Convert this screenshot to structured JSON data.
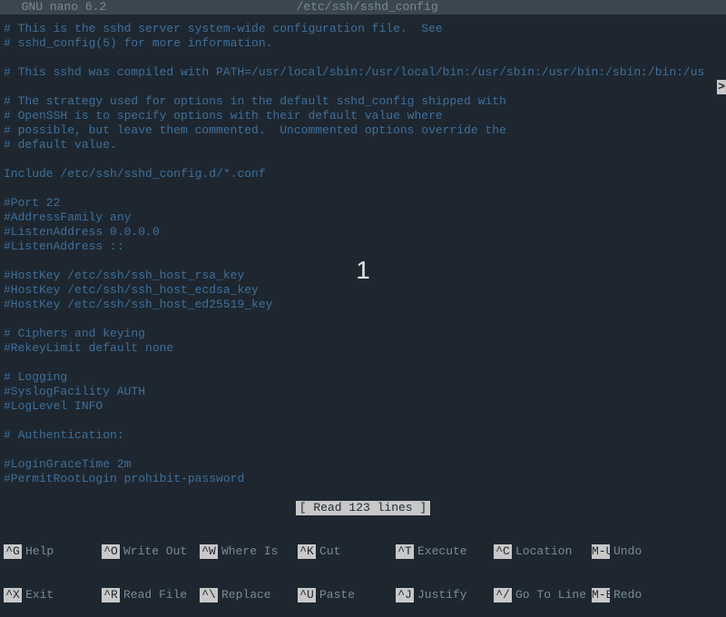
{
  "titlebar": {
    "app": "  GNU nano 6.2",
    "filename": "/etc/ssh/sshd_config"
  },
  "overlay": {
    "big_number": "1"
  },
  "status": {
    "message": "[ Read 123 lines ]"
  },
  "overflow_indicator": ">",
  "file_lines": [
    "# This is the sshd server system-wide configuration file.  See",
    "# sshd_config(5) for more information.",
    "",
    "# This sshd was compiled with PATH=/usr/local/sbin:/usr/local/bin:/usr/sbin:/usr/bin:/sbin:/bin:/us",
    "",
    "# The strategy used for options in the default sshd_config shipped with",
    "# OpenSSH is to specify options with their default value where",
    "# possible, but leave them commented.  Uncommented options override the",
    "# default value.",
    "",
    "Include /etc/ssh/sshd_config.d/*.conf",
    "",
    "#Port 22",
    "#AddressFamily any",
    "#ListenAddress 0.0.0.0",
    "#ListenAddress ::",
    "",
    "#HostKey /etc/ssh/ssh_host_rsa_key",
    "#HostKey /etc/ssh/ssh_host_ecdsa_key",
    "#HostKey /etc/ssh/ssh_host_ed25519_key",
    "",
    "# Ciphers and keying",
    "#RekeyLimit default none",
    "",
    "# Logging",
    "#SyslogFacility AUTH",
    "#LogLevel INFO",
    "",
    "# Authentication:",
    "",
    "#LoginGraceTime 2m",
    "#PermitRootLogin prohibit-password"
  ],
  "shortcuts": {
    "row1": [
      {
        "key": "^G",
        "label": "Help"
      },
      {
        "key": "^O",
        "label": "Write Out"
      },
      {
        "key": "^W",
        "label": "Where Is"
      },
      {
        "key": "^K",
        "label": "Cut"
      },
      {
        "key": "^T",
        "label": "Execute"
      },
      {
        "key": "^C",
        "label": "Location"
      },
      {
        "key": "M-U",
        "label": "Undo"
      }
    ],
    "row2": [
      {
        "key": "^X",
        "label": "Exit"
      },
      {
        "key": "^R",
        "label": "Read File"
      },
      {
        "key": "^\\",
        "label": "Replace"
      },
      {
        "key": "^U",
        "label": "Paste"
      },
      {
        "key": "^J",
        "label": "Justify"
      },
      {
        "key": "^/",
        "label": "Go To Line"
      },
      {
        "key": "M-E",
        "label": "Redo"
      }
    ]
  }
}
